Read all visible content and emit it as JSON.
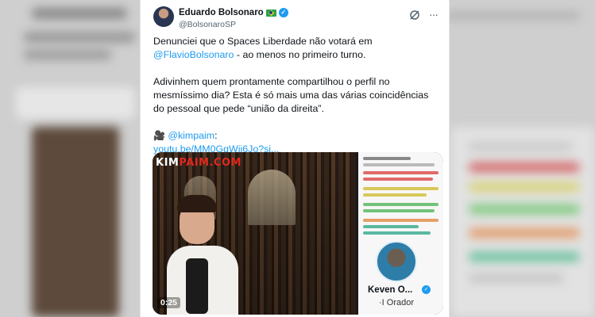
{
  "tweet": {
    "author_name": "Eduardo Bolsonaro",
    "author_handle": "@BolsonaroSP",
    "verified_badge": "✓",
    "text_p1_a": "Denunciei que o Spaces Liberdade não votará em ",
    "text_p1_mention": "@FlavioBolsonaro",
    "text_p1_b": " - ao menos no primeiro turno.",
    "text_p2": "Adivinhem quem prontamente compartilhou o perfil no mesmíssimo dia? Esta é só mais uma das várias coincidências do pessoal que pede “união da direita”.",
    "camera_glyph": "🎥",
    "credit_mention": "@kimpaim",
    "credit_suffix": ":",
    "video_link": "youtu.be/MM0GgWjj6Jo?si..."
  },
  "media": {
    "logo_white": "KIM",
    "logo_red": "PAIM.COM",
    "timestamp": "0:25",
    "screenshot_name": "Keven O...",
    "screenshot_role": "·I Orador"
  },
  "colors": {
    "link": "#1d9bf0",
    "text": "#0f1419",
    "logo_red": "#e0281e"
  },
  "icons": [
    "avatar",
    "brazil-flag-icon",
    "verified-icon",
    "grok-icon",
    "more-icon",
    "camera-icon"
  ]
}
